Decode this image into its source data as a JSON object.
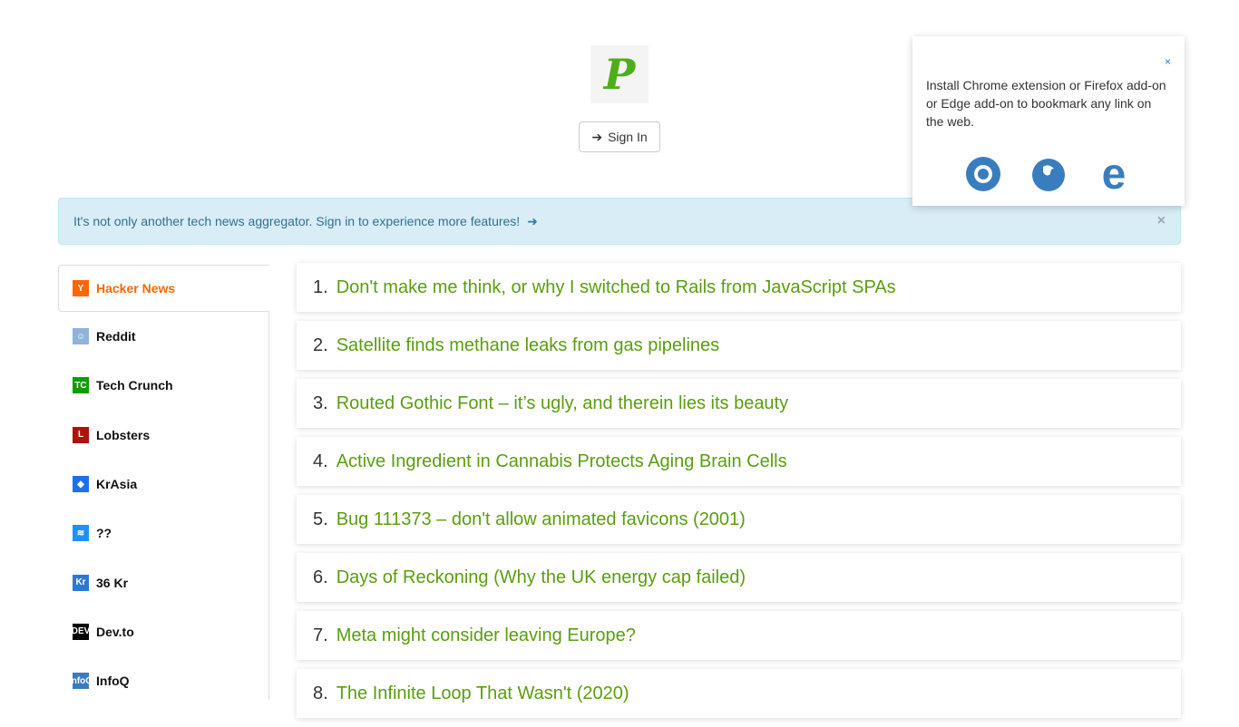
{
  "header": {
    "logo_letter": "P",
    "signin_label": "Sign In"
  },
  "popup": {
    "close": "×",
    "text": "Install Chrome extension or Firefox add-on or Edge add-on to bookmark any link on the web.",
    "browsers": [
      "chrome-icon",
      "firefox-icon",
      "edge-icon"
    ]
  },
  "alert": {
    "text": "It's not only another tech news aggregator. Sign in to experience more features!",
    "close": "×"
  },
  "sidebar": {
    "items": [
      {
        "label": "Hacker News",
        "icon": "Y",
        "color": "#ff6600"
      },
      {
        "label": "Reddit",
        "icon": "☺",
        "color": "#8fb3d9"
      },
      {
        "label": "Tech Crunch",
        "icon": "TC",
        "color": "#0a9e01"
      },
      {
        "label": "Lobsters",
        "icon": "L",
        "color": "#ac130d"
      },
      {
        "label": "KrAsia",
        "icon": "◆",
        "color": "#1e6ff0"
      },
      {
        "label": "??",
        "icon": "≋",
        "color": "#1e90ff"
      },
      {
        "label": "36 Kr",
        "icon": "Kr",
        "color": "#2a7ad3"
      },
      {
        "label": "Dev.to",
        "icon": "DEV",
        "color": "#000000"
      },
      {
        "label": "InfoQ",
        "icon": "InfoQ",
        "color": "#3a7bbf"
      }
    ]
  },
  "articles": [
    {
      "n": "1.",
      "title": "Don't make me think, or why I switched to Rails from JavaScript SPAs"
    },
    {
      "n": "2.",
      "title": "Satellite finds methane leaks from gas pipelines"
    },
    {
      "n": "3.",
      "title": "Routed Gothic Font – it’s ugly, and therein lies its beauty"
    },
    {
      "n": "4.",
      "title": "Active Ingredient in Cannabis Protects Aging Brain Cells"
    },
    {
      "n": "5.",
      "title": "Bug 111373 – don't allow animated favicons (2001)"
    },
    {
      "n": "6.",
      "title": "Days of Reckoning (Why the UK energy cap failed)"
    },
    {
      "n": "7.",
      "title": "Meta might consider leaving Europe?"
    },
    {
      "n": "8.",
      "title": "The Infinite Loop That Wasn't (2020)"
    }
  ]
}
